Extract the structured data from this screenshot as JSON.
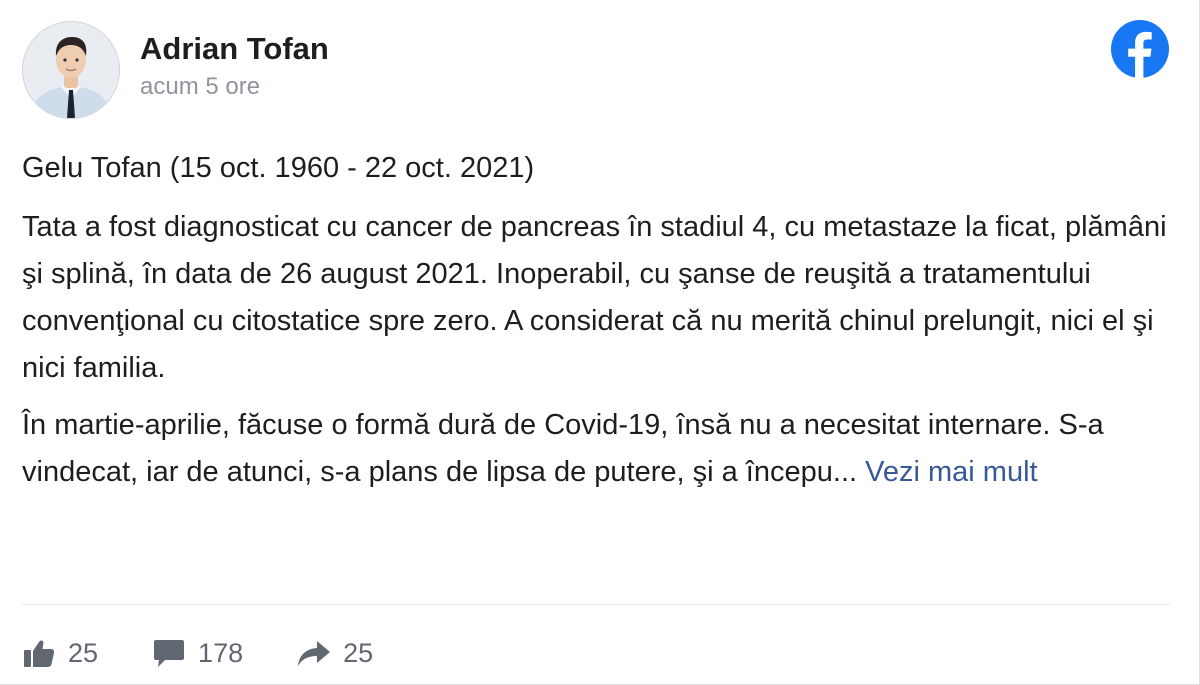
{
  "post": {
    "author": {
      "name": "Adrian Tofan",
      "avatar_icon": "profile-photo"
    },
    "timestamp": "acum 5 ore",
    "brand_icon": "facebook-logo-icon",
    "brand_color": "#1877f2",
    "title_line": "Gelu Tofan (15 oct. 1960 - 22 oct. 2021)",
    "paragraphs": [
      "Tata a fost diagnosticat cu cancer de pancreas în stadiul 4, cu metastaze la ficat, plămâni şi splină, în data de 26 august 2021. Inoperabil, cu şanse de reuşită a tratamentului convenţional cu citostatice spre zero. A considerat că nu merită chinul prelungit, nici el şi nici familia.",
      "În martie-aprilie, făcuse o formă dură de Covid-19, însă nu a necesitat internare. S-a vindecat, iar de atunci, s-a plans de lipsa de putere, şi a începu..."
    ],
    "see_more_label": "Vezi mai mult",
    "link_color": "#385898"
  },
  "actions": {
    "likes": {
      "icon": "thumbs-up-icon",
      "count": "25"
    },
    "comments": {
      "icon": "comment-bubble-icon",
      "count": "178"
    },
    "shares": {
      "icon": "share-arrow-icon",
      "count": "25"
    }
  }
}
